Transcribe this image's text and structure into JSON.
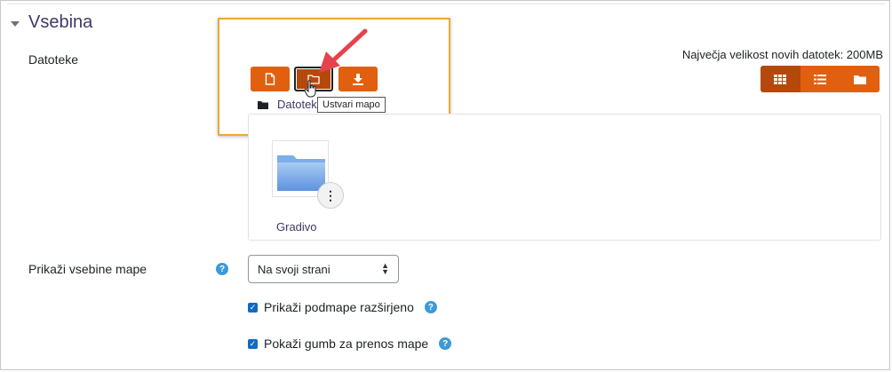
{
  "section": {
    "title": "Vsebina",
    "toggle_icon": "caret-down-icon"
  },
  "files_field": {
    "label": "Datoteke",
    "max_size_text": "Največja velikost novih datotek: 200MB",
    "toolbar": {
      "add_file_icon": "file-icon",
      "create_folder_icon": "folder-icon",
      "download_icon": "download-icon"
    },
    "tooltip": "Ustvari mapo",
    "path_label": "Datoteke",
    "view_modes": [
      "grid-icon",
      "list-icon",
      "tree-folder-icon"
    ],
    "files": [
      {
        "name": "Gradivo",
        "icon": "folder-icon"
      }
    ],
    "menu_glyph": "⋮"
  },
  "display_field": {
    "label": "Prikaži vsebine mape",
    "help_glyph": "?",
    "select_value": "Na svoji strani"
  },
  "checkboxes": [
    {
      "label": "Prikaži podmape razširjeno",
      "checked": true
    },
    {
      "label": "Pokaži gumb za prenos mape",
      "checked": true
    }
  ],
  "colors": {
    "accent": "#e0600f",
    "accent_active": "#b5480a",
    "highlight": "#f0a830",
    "link": "#3d3a69",
    "help": "#3d9ad6"
  }
}
